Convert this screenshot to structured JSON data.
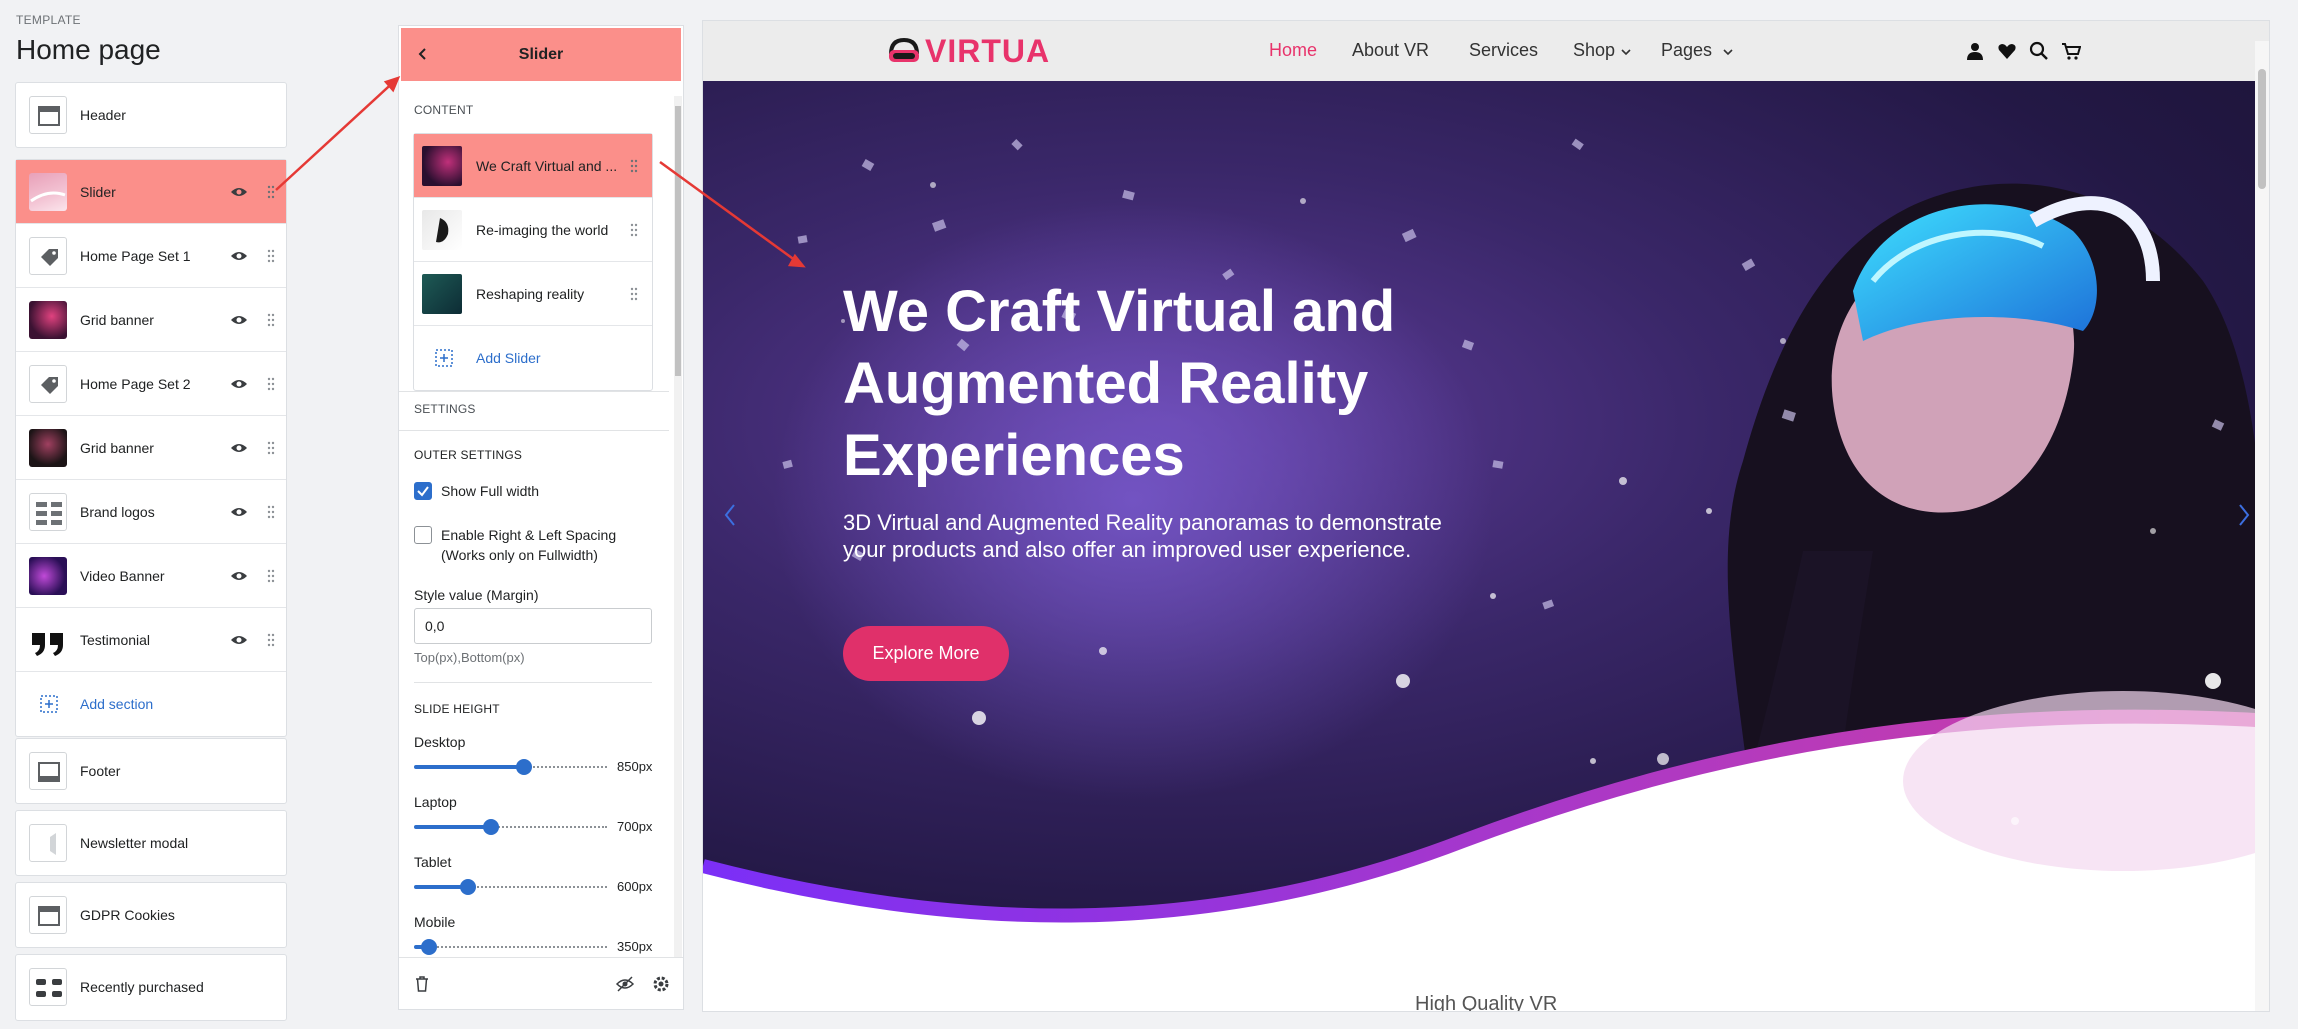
{
  "sidebar": {
    "template_label": "TEMPLATE",
    "page_title": "Home page",
    "header_item": "Header",
    "sections": [
      {
        "label": "Slider",
        "thumb": "slider"
      },
      {
        "label": "Home Page Set 1",
        "thumb": "tag"
      },
      {
        "label": "Grid banner",
        "thumb": "vr-pink"
      },
      {
        "label": "Home Page Set 2",
        "thumb": "tag"
      },
      {
        "label": "Grid banner",
        "thumb": "vr-dark"
      },
      {
        "label": "Brand logos",
        "thumb": "logos"
      },
      {
        "label": "Video Banner",
        "thumb": "video"
      },
      {
        "label": "Testimonial",
        "thumb": "quote"
      }
    ],
    "add_section": "Add section",
    "footer_item": "Footer",
    "newsletter_item": "Newsletter modal",
    "gdpr_item": "GDPR Cookies",
    "recent_item": "Recently purchased"
  },
  "panel": {
    "title": "Slider",
    "content_caption": "CONTENT",
    "blocks": [
      {
        "label": "We Craft Virtual and ..."
      },
      {
        "label": "Re-imaging the world"
      },
      {
        "label": "Reshaping reality"
      }
    ],
    "add_slider": "Add Slider",
    "settings_caption": "SETTINGS",
    "outer_settings": "OUTER SETTINGS",
    "show_full_width": "Show Full width",
    "show_full_width_checked": true,
    "spacing_line1": "Enable Right & Left Spacing",
    "spacing_line2": "(Works only on Fullwidth)",
    "spacing_checked": false,
    "style_label": "Style value (Margin)",
    "style_value": "0,0",
    "style_hint": "Top(px),Bottom(px)",
    "slide_height": "SLIDE HEIGHT",
    "ranges": [
      {
        "label": "Desktop",
        "value": "850px",
        "fraction": 0.57
      },
      {
        "label": "Laptop",
        "value": "700px",
        "fraction": 0.4
      },
      {
        "label": "Tablet",
        "value": "600px",
        "fraction": 0.28
      },
      {
        "label": "Mobile",
        "value": "350px",
        "fraction": 0.08
      }
    ]
  },
  "preview": {
    "logo": "VIRTUA",
    "nav": [
      "Home",
      "About VR",
      "Services",
      "Shop",
      "Pages"
    ],
    "headline": "We Craft Virtual and Augmented Reality Experiences",
    "subtext": "3D Virtual and Augmented Reality panoramas to demonstrate your products and also offer an improved user experience.",
    "cta": "Explore More",
    "below_text": "High Quality VR"
  },
  "colors": {
    "accent": "#e8336b",
    "highlight": "#fb8f8a",
    "link": "#2c6ecb",
    "hero_bg": "#2a1d52"
  }
}
